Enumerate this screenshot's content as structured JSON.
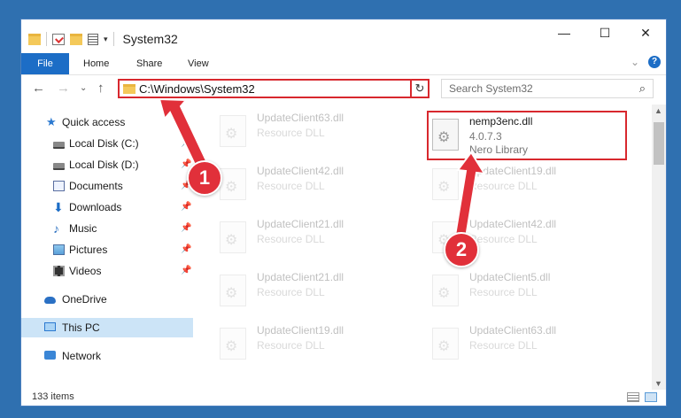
{
  "title": {
    "folder_name": "System32"
  },
  "window_controls": {
    "minimize": "—",
    "maximize": "☐",
    "close": "✕"
  },
  "ribbon": {
    "tabs": [
      "File",
      "Home",
      "Share",
      "View"
    ],
    "expand": "⌄",
    "help": "?"
  },
  "address": {
    "path": "C:\\Windows\\System32",
    "dropdown": "⌄",
    "refresh": "↻"
  },
  "navbuttons": {
    "back": "←",
    "forward": "→",
    "recent": "⌄",
    "up": "↑"
  },
  "search": {
    "placeholder": "Search System32",
    "icon": "⌕"
  },
  "nav": {
    "items": [
      {
        "label": "Quick access",
        "icon": "star-icon",
        "pinned": false
      },
      {
        "label": "Local Disk (C:)",
        "icon": "drive-icon",
        "pinned": true
      },
      {
        "label": "Local Disk (D:)",
        "icon": "drive-icon",
        "pinned": true
      },
      {
        "label": "Documents",
        "icon": "documents-icon",
        "pinned": true
      },
      {
        "label": "Downloads",
        "icon": "download-icon",
        "pinned": true
      },
      {
        "label": "Music",
        "icon": "music-icon",
        "pinned": true
      },
      {
        "label": "Pictures",
        "icon": "pictures-icon",
        "pinned": true
      },
      {
        "label": "Videos",
        "icon": "videos-icon",
        "pinned": true
      },
      {
        "label": "OneDrive",
        "icon": "cloud-icon",
        "pinned": false
      },
      {
        "label": "This PC",
        "icon": "computer-icon",
        "pinned": false,
        "selected": true
      },
      {
        "label": "Network",
        "icon": "network-icon",
        "pinned": false
      }
    ],
    "pin_glyph": "📌"
  },
  "files": {
    "highlighted": {
      "name": "nemp3enc.dll",
      "version": "4.0.7.3",
      "description": "Nero Library"
    },
    "left_column": [
      {
        "name": "UpdateClient63.dll",
        "description": "Resource DLL"
      },
      {
        "name": "UpdateClient42.dll",
        "description": "Resource DLL"
      },
      {
        "name": "UpdateClient21.dll",
        "description": "Resource DLL"
      },
      {
        "name": "UpdateClient21.dll",
        "description": "Resource DLL"
      },
      {
        "name": "UpdateClient19.dll",
        "description": "Resource DLL"
      }
    ],
    "right_column": [
      {
        "name": "UpdateClient19.dll",
        "description": "Resource DLL"
      },
      {
        "name": "UpdateClient42.dll",
        "description": "Resource DLL"
      },
      {
        "name": "UpdateClient5.dll",
        "description": "Resource DLL"
      },
      {
        "name": "UpdateClient63.dll",
        "description": "Resource DLL"
      }
    ]
  },
  "status": {
    "item_count": "133 items"
  },
  "annotations": {
    "badge_1": "1",
    "badge_2": "2",
    "color": "#e1303a"
  },
  "colors": {
    "accent": "#1c6dc6",
    "highlight_border": "#d8282e",
    "selection": "#cce4f7",
    "desktop": "#2f70b0"
  }
}
